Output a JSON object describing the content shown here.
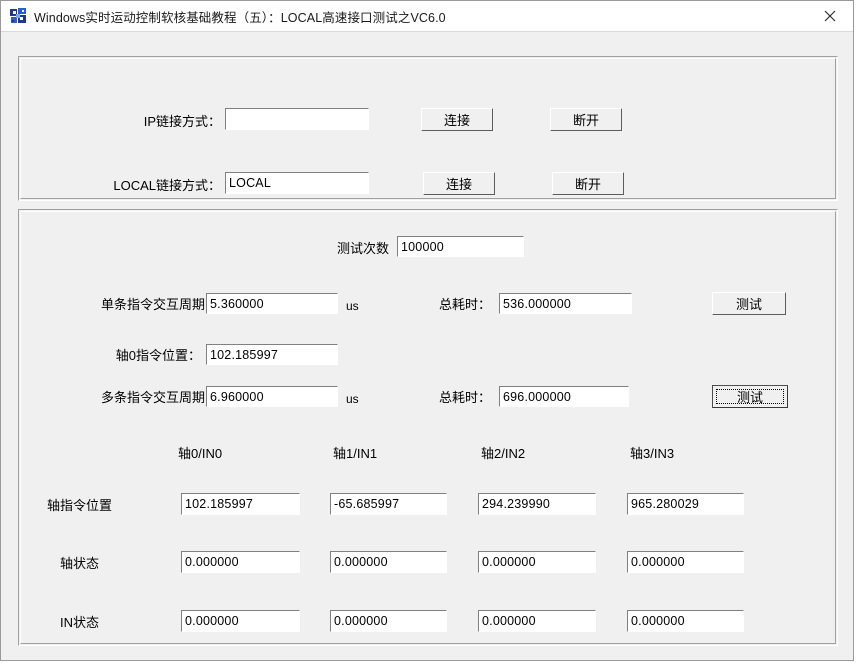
{
  "window": {
    "title": "Windows实时运动控制软核基础教程（五）：LOCAL高速接口测试之VC6.0",
    "icon": "app-icon",
    "close_label": "✕",
    "background_color": "#f0f0f0",
    "titlebar_color": "#ffffff"
  },
  "connection_panel": {
    "rows": [
      {
        "label": "IP链接方式：",
        "value": "",
        "connect_label": "连接",
        "disconnect_label": "断开"
      },
      {
        "label": "LOCAL链接方式：",
        "value": "LOCAL",
        "connect_label": "连接",
        "disconnect_label": "断开"
      }
    ]
  },
  "test_panel": {
    "test_count": {
      "label": "测试次数",
      "value": "100000"
    },
    "single_cmd": {
      "label": "单条指令交互周期：",
      "value": "5.360000",
      "unit": "us",
      "total_label": "总耗时：",
      "total_value": "536.000000",
      "button_label": "测试",
      "focused": false
    },
    "axis0_position": {
      "label": "轴0指令位置：",
      "value": "102.185997"
    },
    "multi_cmd": {
      "label": "多条指令交互周期：",
      "value": "6.960000",
      "unit": "us",
      "total_label": "总耗时：",
      "total_value": "696.000000",
      "button_label": "测试",
      "focused": true
    },
    "columns": [
      "轴0/IN0",
      "轴1/IN1",
      "轴2/IN2",
      "轴3/IN3"
    ],
    "rows": [
      {
        "label": "轴指令位置",
        "values": [
          "102.185997",
          "-65.685997",
          "294.239990",
          "965.280029"
        ]
      },
      {
        "label": "轴状态",
        "values": [
          "0.000000",
          "0.000000",
          "0.000000",
          "0.000000"
        ]
      },
      {
        "label": "IN状态",
        "values": [
          "0.000000",
          "0.000000",
          "0.000000",
          "0.000000"
        ]
      }
    ]
  }
}
